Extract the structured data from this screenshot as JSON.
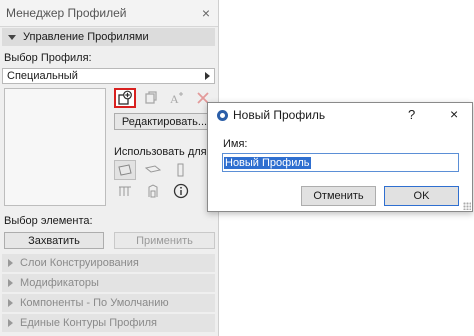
{
  "panel": {
    "title": "Менеджер Профилей",
    "close_glyph": "×",
    "manage_section": "Управление Профилями",
    "select_profile_label": "Выбор Профиля:",
    "profile_dropdown_value": "Специальный",
    "edit_button": "Редактировать...",
    "use_for_label": "Использовать для:",
    "select_element_label": "Выбор элемента:",
    "capture_button": "Захватить",
    "apply_button": "Применить",
    "collapsed_sections": [
      {
        "label": "Слои Конструирования"
      },
      {
        "label": "Модификаторы"
      },
      {
        "label": "Компоненты - По Умолчанию"
      },
      {
        "label": "Единые Контуры Профиля"
      }
    ],
    "tool_icons": [
      "new-profile-icon",
      "duplicate-profile-icon",
      "rename-icon",
      "delete-icon"
    ],
    "use_icons": [
      "wall-icon",
      "beam-icon",
      "column-icon",
      "railing-icon",
      "opening-icon",
      "info-icon"
    ]
  },
  "dialog": {
    "title": "Новый Профиль",
    "help_glyph": "?",
    "close_glyph": "×",
    "name_label": "Имя:",
    "name_value": "Новый Профиль",
    "cancel_button": "Отменить",
    "ok_button": "OK"
  },
  "colors": {
    "highlight_border": "#d8201f",
    "selection": "#2f6fd0",
    "dialog_logo": "#2b5ea8"
  }
}
